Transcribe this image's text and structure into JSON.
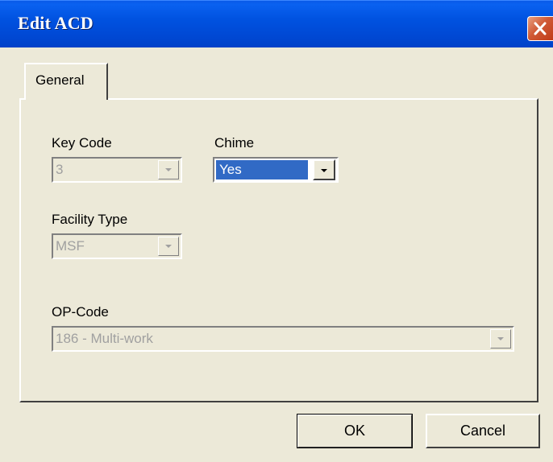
{
  "window": {
    "title": "Edit ACD",
    "close_icon": "close-icon"
  },
  "tabs": [
    {
      "label": "General",
      "selected": true
    }
  ],
  "form": {
    "key_code": {
      "label": "Key Code",
      "value": "3",
      "enabled": false
    },
    "chime": {
      "label": "Chime",
      "value": "Yes",
      "enabled": true,
      "focused": true
    },
    "facility_type": {
      "label": "Facility Type",
      "value": "MSF",
      "enabled": false
    },
    "op_code": {
      "label": "OP-Code",
      "value": "186 - Multi-work",
      "enabled": false
    }
  },
  "buttons": {
    "ok": "OK",
    "cancel": "Cancel"
  },
  "colors": {
    "titlebar": "#0052e0",
    "dialog_bg": "#ece9d8",
    "selection": "#316ac5",
    "close_button": "#d05a36"
  }
}
